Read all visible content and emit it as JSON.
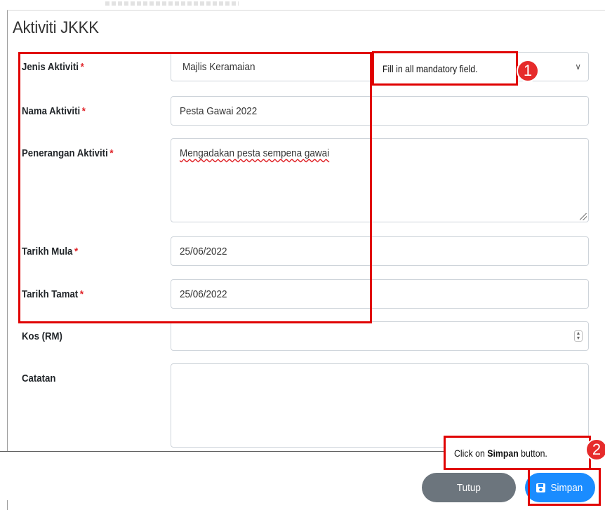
{
  "modal": {
    "title": "Aktiviti JKKK",
    "fields": {
      "jenis": {
        "label": "Jenis Aktiviti",
        "required": "*",
        "value": "Majlis Keramaian"
      },
      "nama": {
        "label": "Nama Aktiviti",
        "required": "*",
        "value": "Pesta Gawai 2022"
      },
      "penerangan": {
        "label": "Penerangan Aktiviti",
        "required": "*",
        "value": "Mengadakan pesta sempena gawai"
      },
      "tarikh_mula": {
        "label": "Tarikh Mula",
        "required": "*",
        "value": "25/06/2022"
      },
      "tarikh_tamat": {
        "label": "Tarikh Tamat",
        "required": "*",
        "value": "25/06/2022"
      },
      "kos": {
        "label": "Kos (RM)",
        "value": ""
      },
      "catatan": {
        "label": "Catatan",
        "value": ""
      }
    },
    "buttons": {
      "tutup": "Tutup",
      "simpan": "Simpan"
    }
  },
  "annotations": {
    "step1": {
      "number": "1",
      "text": "Fill in all mandatory field."
    },
    "step2": {
      "number": "2",
      "text_before": "Click on ",
      "text_bold": "Simpan",
      "text_after": " button."
    }
  },
  "colors": {
    "highlight": "#e00000",
    "primary": "#1a8cff",
    "secondary": "#6c757d",
    "required": "#e0262b"
  },
  "icons": [
    "chevron-down-icon",
    "resize-grip-icon",
    "spinner-icon",
    "save-icon"
  ]
}
